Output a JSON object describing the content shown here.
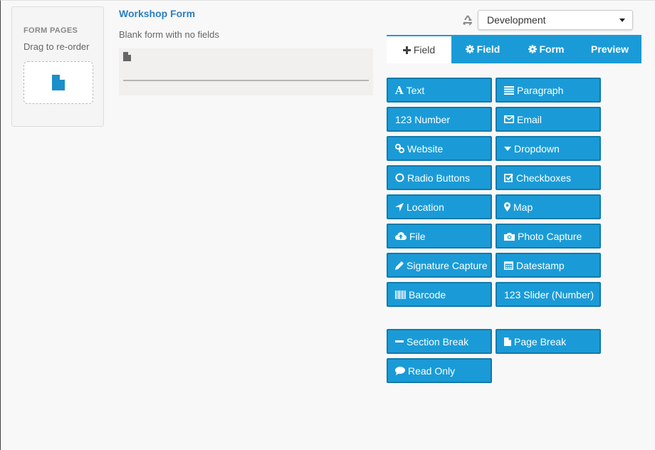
{
  "sidebar": {
    "heading": "FORM PAGES",
    "subtitle": "Drag to re-order"
  },
  "form": {
    "title": "Workshop Form",
    "description": "Blank form with no fields"
  },
  "environment": {
    "selected": "Development"
  },
  "tabs": [
    {
      "label": "Field",
      "icon": "plus-icon",
      "active": true
    },
    {
      "label": "Field",
      "icon": "gear-icon",
      "active": false
    },
    {
      "label": "Form",
      "icon": "gear-icon",
      "active": false
    },
    {
      "label": "Preview",
      "icon": "",
      "active": false
    }
  ],
  "fields": {
    "text": "Text",
    "paragraph": "Paragraph",
    "number": "123 Number",
    "email": "Email",
    "website": "Website",
    "dropdown": "Dropdown",
    "radio": "Radio Buttons",
    "checkboxes": "Checkboxes",
    "location": "Location",
    "map": "Map",
    "file": "File",
    "photo": "Photo Capture",
    "signature": "Signature Capture",
    "datestamp": "Datestamp",
    "barcode": "Barcode",
    "slider": "123 Slider (Number)",
    "section_break": "Section Break",
    "page_break": "Page Break",
    "read_only": "Read Only"
  },
  "colors": {
    "accent": "#1a9bd7",
    "accent_border": "#117bab",
    "title": "#2b7fc2"
  }
}
